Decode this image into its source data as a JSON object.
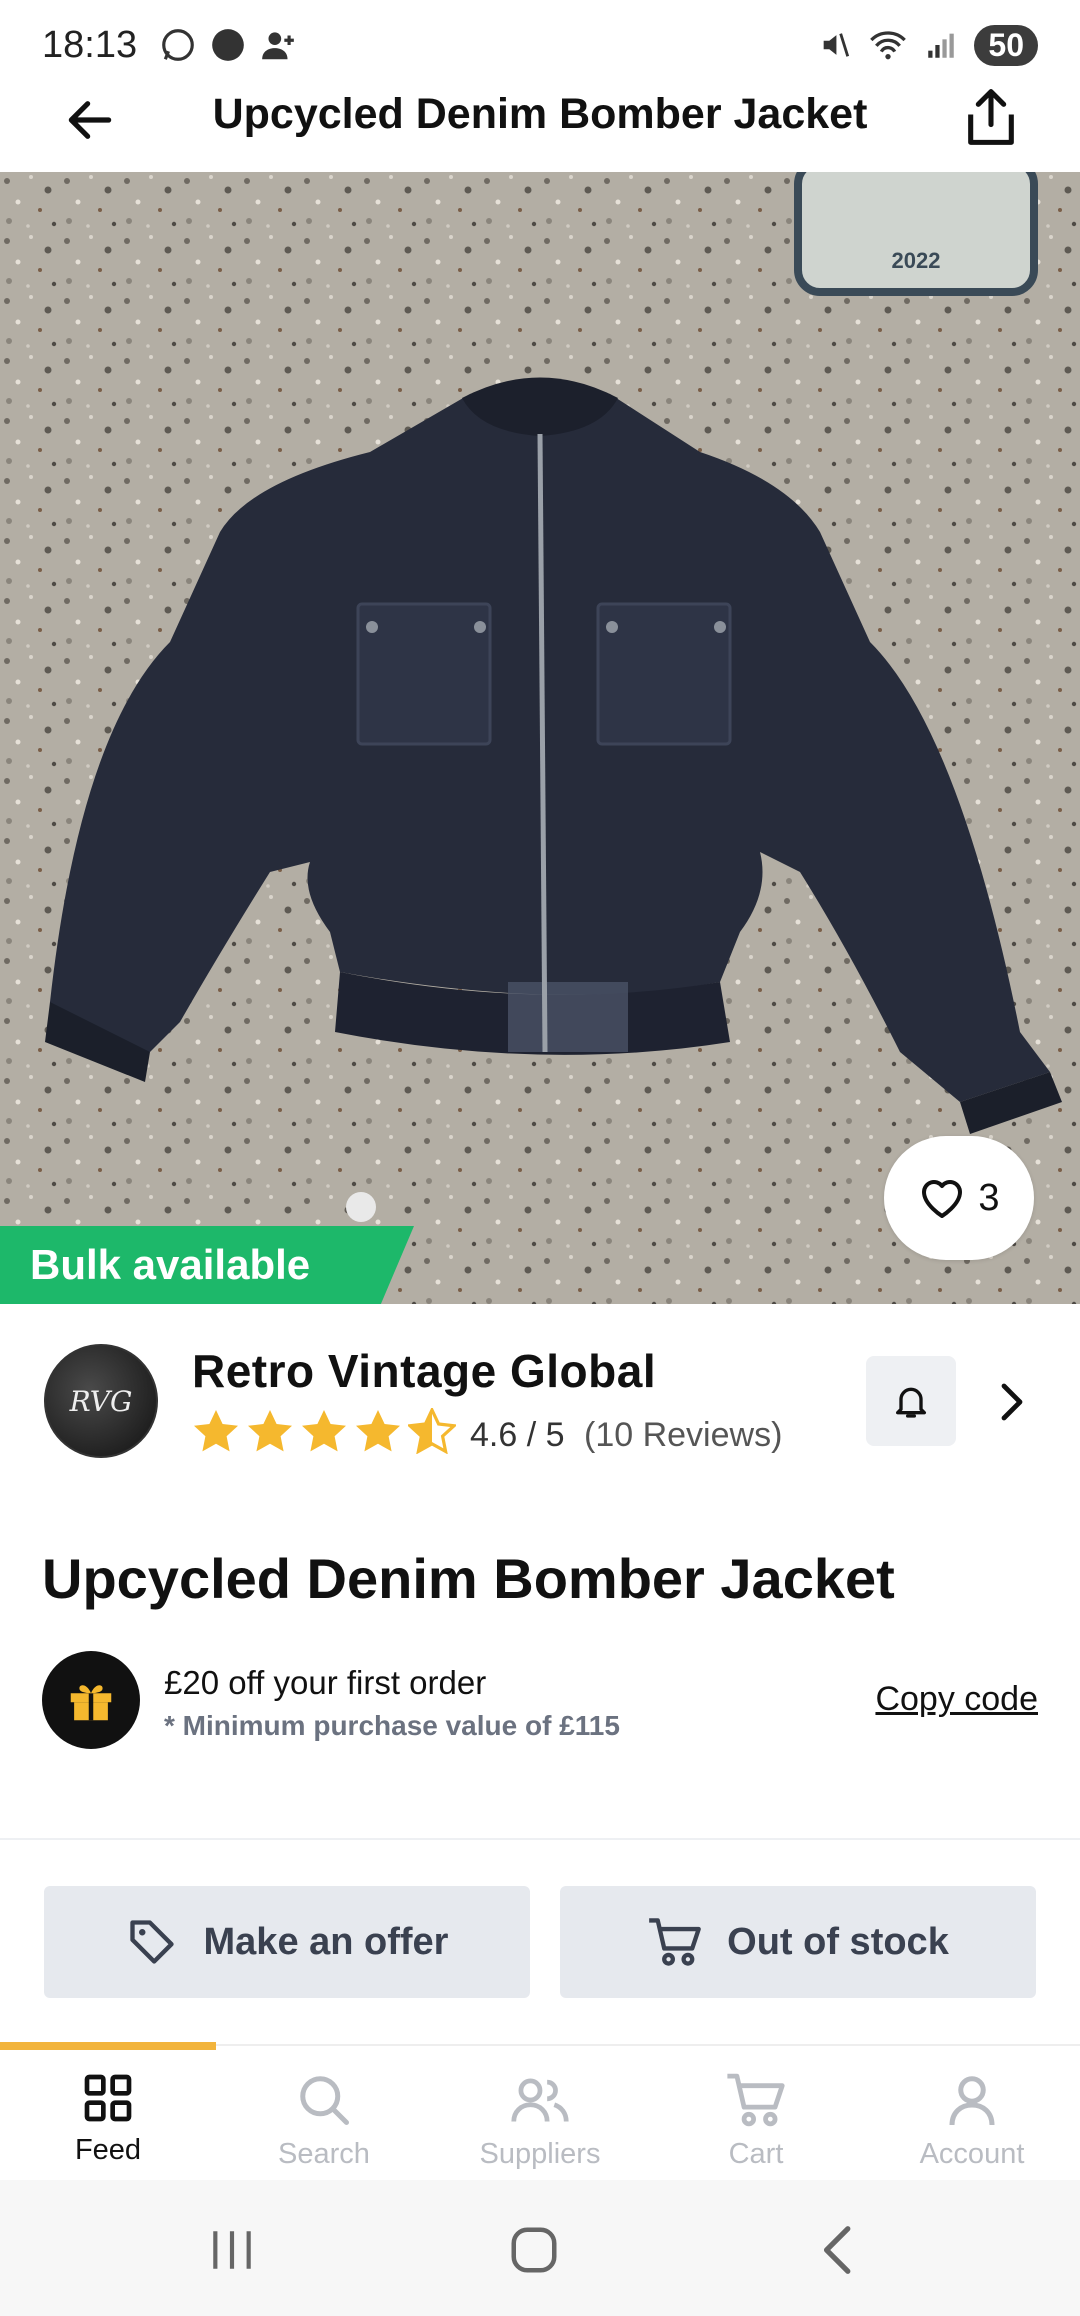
{
  "status_bar": {
    "time": "18:13",
    "battery": "50"
  },
  "header": {
    "title": "Upcycled Denim Bomber Jacket"
  },
  "gallery": {
    "likes": "3",
    "bulk_label": "Bulk available",
    "image_subject": "navy denim bomber jacket on terrazzo floor"
  },
  "supplier": {
    "name": "Retro Vintage Global",
    "avatar_initials": "RVG",
    "rating_value": 4.6,
    "rating_text": "4.6 / 5",
    "reviews_text": "(10 Reviews)"
  },
  "product": {
    "title": "Upcycled Denim Bomber Jacket"
  },
  "promo": {
    "title": "£20 off your first order",
    "subtitle": "* Minimum purchase value of £115",
    "action": "Copy code"
  },
  "actions": {
    "offer_label": "Make an offer",
    "stock_label": "Out of stock"
  },
  "nav": {
    "items": [
      {
        "label": "Feed",
        "icon": "grid-icon",
        "active": true
      },
      {
        "label": "Search",
        "icon": "search-icon",
        "active": false
      },
      {
        "label": "Suppliers",
        "icon": "users-icon",
        "active": false
      },
      {
        "label": "Cart",
        "icon": "cart-icon",
        "active": false
      },
      {
        "label": "Account",
        "icon": "user-icon",
        "active": false
      }
    ]
  },
  "colors": {
    "accent_green": "#1db86a",
    "star_yellow": "#f5b82e",
    "nav_indicator": "#f2b43c",
    "button_bg": "#e6e9ee"
  }
}
